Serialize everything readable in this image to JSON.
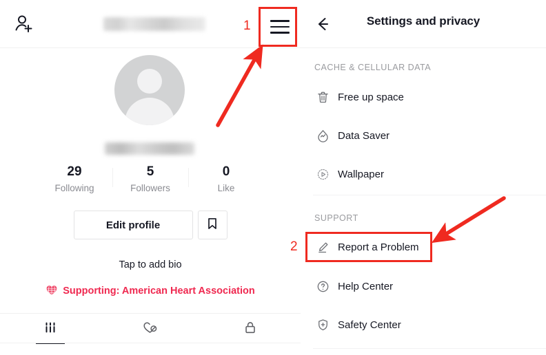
{
  "app": {
    "accent_red": "#ef2a20",
    "brand_pink": "#ef2950",
    "text_primary": "#161823",
    "text_muted": "#8a8b91"
  },
  "profile": {
    "header": {
      "add_person_icon": "add-person-icon",
      "username_blurred": "",
      "menu_icon": "hamburger-menu-icon"
    },
    "avatar_icon": "default-avatar-icon",
    "handle_blurred": "",
    "stats": [
      {
        "value": "29",
        "label": "Following"
      },
      {
        "value": "5",
        "label": "Followers"
      },
      {
        "value": "0",
        "label": "Like"
      }
    ],
    "edit_profile_label": "Edit profile",
    "bookmark_icon": "bookmark-icon",
    "bio_placeholder": "Tap to add bio",
    "supporting_text": "Supporting: American Heart Association",
    "supporting_icon": "heart-globe-icon",
    "tabs": [
      {
        "icon": "grid-posts-icon",
        "name": "posts",
        "active": true
      },
      {
        "icon": "heart-slash-liked-icon",
        "name": "liked",
        "active": false
      },
      {
        "icon": "lock-private-icon",
        "name": "private",
        "active": false
      }
    ]
  },
  "settings": {
    "back_icon": "back-arrow-icon",
    "title": "Settings and privacy",
    "sections": [
      {
        "label": "CACHE & CELLULAR DATA",
        "items": [
          {
            "icon": "trash-icon",
            "label": "Free up space"
          },
          {
            "icon": "data-saver-droplet-icon",
            "label": "Data Saver"
          },
          {
            "icon": "wallpaper-play-icon",
            "label": "Wallpaper"
          }
        ]
      },
      {
        "label": "SUPPORT",
        "items": [
          {
            "icon": "pencil-icon",
            "label": "Report a Problem"
          },
          {
            "icon": "question-circle-icon",
            "label": "Help Center"
          },
          {
            "icon": "shield-plus-icon",
            "label": "Safety Center"
          }
        ]
      }
    ]
  },
  "annotations": {
    "steps": [
      {
        "number": "1",
        "target": "hamburger-menu-icon"
      },
      {
        "number": "2",
        "target": "report-a-problem-row"
      }
    ]
  }
}
